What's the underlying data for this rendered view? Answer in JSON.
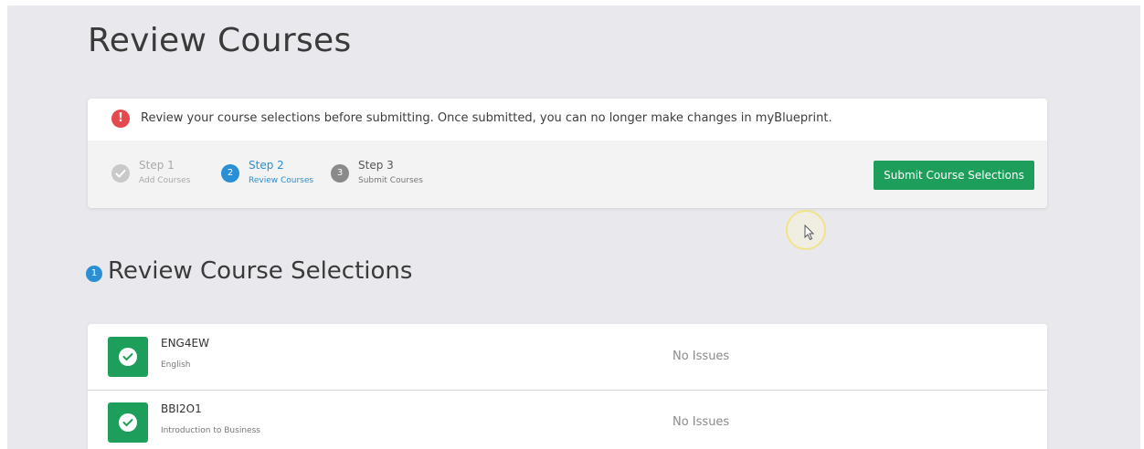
{
  "page": {
    "title": "Review Courses"
  },
  "alert": {
    "icon": "exclamation-icon",
    "text": "Review your course selections before submitting. Once submitted, you can no longer make changes in myBlueprint.",
    "color": "#e5484d"
  },
  "steps": [
    {
      "label": "Step 1",
      "sub": "Add Courses",
      "state": "completed",
      "icon": "check-icon"
    },
    {
      "label": "Step 2",
      "sub": "Review Courses",
      "state": "active",
      "number": "2"
    },
    {
      "label": "Step 3",
      "sub": "Submit Courses",
      "state": "upcoming",
      "number": "3"
    }
  ],
  "submit_button": {
    "label": "Submit Course Selections",
    "color": "#1d9e5a"
  },
  "section": {
    "badge": "1",
    "title": "Review Course Selections"
  },
  "courses": [
    {
      "code": "ENG4EW",
      "name": "English",
      "status": "No Issues",
      "icon": "check-icon"
    },
    {
      "code": "BBI2O1",
      "name": "Introduction to Business",
      "status": "No Issues",
      "icon": "check-icon"
    }
  ],
  "colors": {
    "accent_blue": "#2a8fd4",
    "success_green": "#1d9e5a",
    "background": "#e9e8ec"
  }
}
